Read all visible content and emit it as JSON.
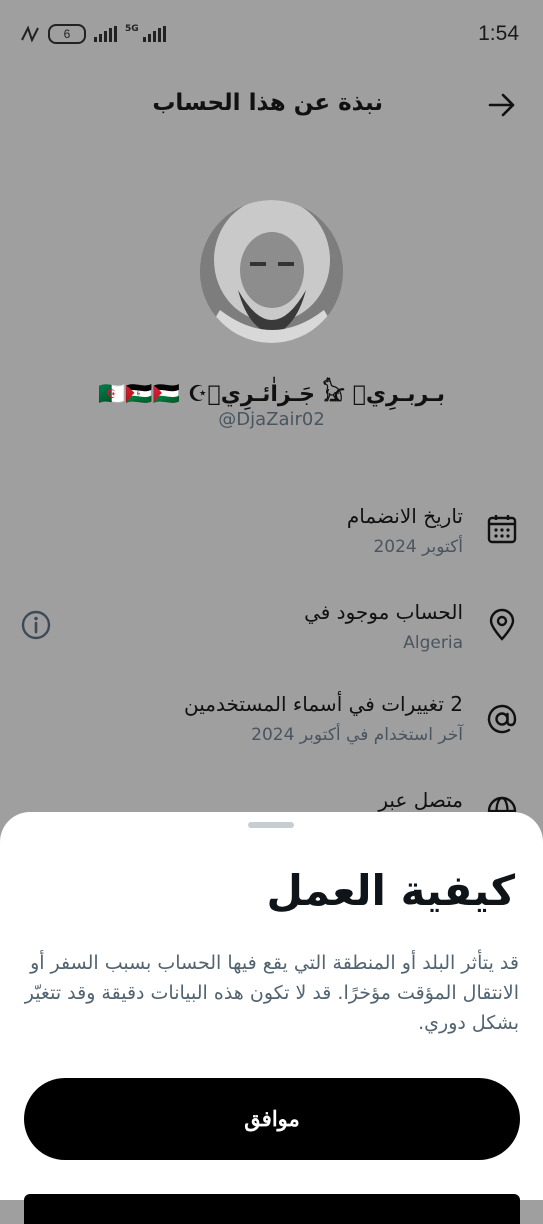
{
  "status_bar": {
    "time": "1:54",
    "battery": "6",
    "network": "5G"
  },
  "header": {
    "title": "نبذة عن هذا الحساب"
  },
  "profile": {
    "display_name": "بـربـرِيۘ 𓃠 جَـزاٰئـرِيۘ☪︎ 🇩🇿🇪🇭🇵🇸",
    "handle": "@DjaZair02"
  },
  "info": {
    "joined": {
      "title": "تاريخ الانضمام",
      "value": "أكتوبر 2024",
      "icon": "calendar-icon"
    },
    "location": {
      "title": "الحساب موجود في",
      "value": "Algeria",
      "icon": "location-pin-icon"
    },
    "usernames": {
      "title": "2 تغييرات في أسماء المستخدمين",
      "value": "آخر استخدام في أكتوبر 2024",
      "icon": "at-sign-icon"
    },
    "connected": {
      "title": "متصل عبر",
      "icon": "globe-icon"
    }
  },
  "sheet": {
    "title": "كيفية العمل",
    "body": "قد يتأثر البلد أو المنطقة التي يقع فيها الحساب بسبب السفر أو الانتقال المؤقت مؤخرًا. قد لا تكون هذه البيانات دقيقة وقد تتغيّر بشكل دوري.",
    "ok_label": "موافق"
  },
  "colors": {
    "overlay_bg": "#9f9f9f",
    "primary_button": "#000000",
    "secondary_text": "#536471"
  }
}
